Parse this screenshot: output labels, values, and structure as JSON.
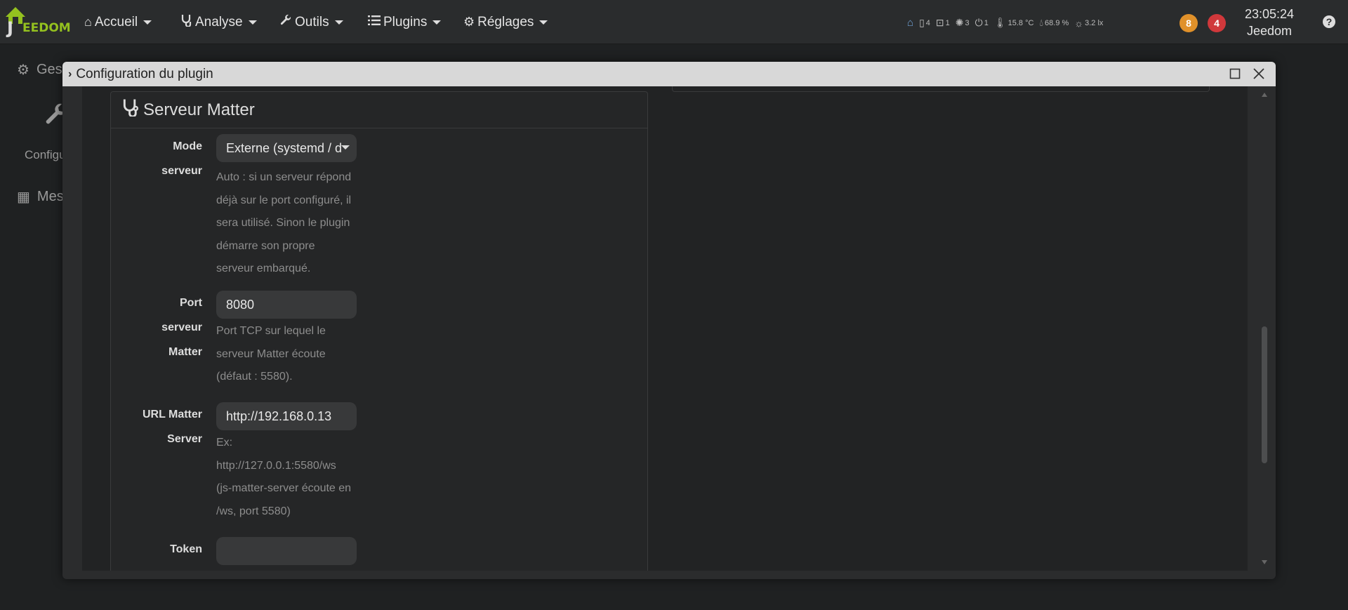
{
  "navbar": {
    "logo_text": "EEDOM",
    "menus": [
      {
        "label": "Accueil",
        "icon": "home-icon"
      },
      {
        "label": "Analyse",
        "icon": "stethoscope-icon"
      },
      {
        "label": "Outils",
        "icon": "wrench-icon"
      },
      {
        "label": "Plugins",
        "icon": "tasks-icon"
      },
      {
        "label": "Réglages",
        "icon": "gear-icon"
      }
    ],
    "status": {
      "openings": "4",
      "shutters": "1",
      "lights": "3",
      "outlets": "1",
      "temperature": "15.8 °C",
      "humidity": "68.9 %",
      "luminosity": "3.2 lx"
    },
    "badges": {
      "warnings": "8",
      "errors": "4"
    },
    "clock": {
      "time": "23:05:24",
      "name": "Jeedom"
    },
    "help": "?"
  },
  "background": {
    "item1": "Ges",
    "item2": "Configu",
    "item3": "Mes"
  },
  "modal": {
    "title": "Configuration du plugin",
    "panel_title": "Serveur Matter",
    "fields": {
      "mode": {
        "label_line1": "Mode",
        "label_line2": "serveur",
        "value": "Externe (systemd / d",
        "help": [
          "Auto : si un serveur répond",
          "déjà sur le port configuré, il",
          "sera utilisé. Sinon le plugin",
          "démarre son propre",
          "serveur embarqué."
        ]
      },
      "port": {
        "label_line1": "Port",
        "label_line2": "serveur",
        "label_line3": "Matter",
        "value": "8080",
        "help": [
          "Port TCP sur lequel le",
          "serveur Matter écoute",
          "(défaut : 5580)."
        ]
      },
      "url": {
        "label_line1": "URL Matter",
        "label_line2": "Server",
        "value": "http://192.168.0.13",
        "help": [
          "Ex:",
          "http://127.0.0.1:5580/ws",
          "(js-matter-server écoute en",
          "/ws, port 5580)"
        ]
      },
      "token": {
        "label": "Token",
        "value": ""
      }
    }
  },
  "colors": {
    "accent": "#94c11f",
    "warning_badge": "#e0912a",
    "error_badge": "#d0383b"
  }
}
